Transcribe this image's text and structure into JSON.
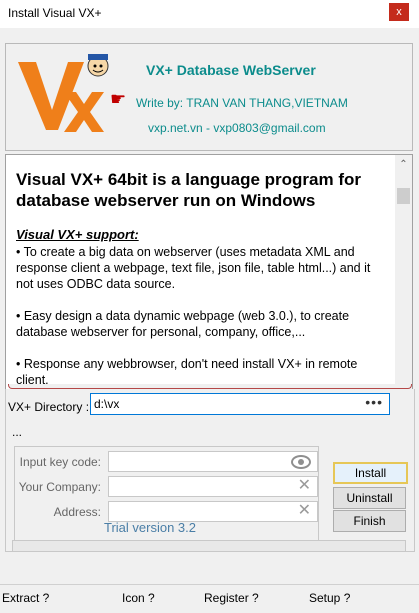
{
  "window": {
    "title": "Install Visual VX+",
    "close_label": "x"
  },
  "header": {
    "app_name": "VX+ Database WebServer",
    "author": "Write by: TRAN VAN THANG,VIETNAM",
    "site": "vxp.net.vn - vxp0803@gmail.com",
    "logo_text": "VX"
  },
  "description": {
    "heading": "Visual VX+ 64bit is a language program for database webserver run on Windows",
    "support_title": "Visual VX+ support:",
    "items": [
      "•  To create a big data on webserver (uses metadata XML and response client a webpage, text file, json file, table html...) and it not uses ODBC data source.",
      "•  Easy design a data dynamic webpage (web 3.0.), to create database webserver for personal, company, office,...",
      "•  Response any webbrowser, don't need install VX+ in remote client."
    ]
  },
  "directory": {
    "label": "VX+ Directory :",
    "value": "d:\\vx",
    "browse": "•••"
  },
  "ellipsis_text": "...",
  "form": {
    "key_label": "Input key code:",
    "company_label": "Your Company:",
    "address_label": "Address:"
  },
  "trial_text": "Trial version 3.2",
  "buttons": {
    "install": "Install",
    "uninstall": "Uninstall",
    "finish": "Finish"
  },
  "menu": {
    "extract": "Extract ?",
    "icon": "Icon ?",
    "register": "Register ?",
    "setup": "Setup ?"
  },
  "colors": {
    "accent": "#0c8c8c",
    "logo_orange": "#ef7f1a",
    "trial": "#4a7ea6"
  }
}
